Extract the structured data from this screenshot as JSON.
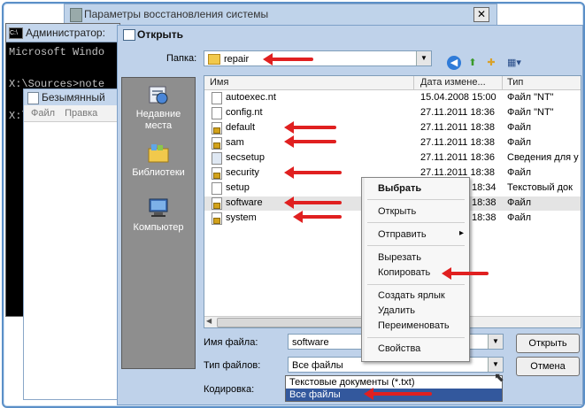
{
  "back_window": {
    "title": "Параметры восстановления системы",
    "close": "✕"
  },
  "console": {
    "title": "Администратор:",
    "icon_text": "C:\\",
    "lines": [
      "Microsoft Windo",
      "",
      "X:\\Sources>note",
      "",
      "X:\\"
    ]
  },
  "notepad": {
    "title": "Безымянный",
    "menu": "Файл  Правка"
  },
  "dialog": {
    "title": "Открыть",
    "folder_label": "Папка:",
    "folder_value": "repair",
    "places": [
      {
        "label": "Недавние места",
        "icon": "recent-places-icon"
      },
      {
        "label": "Библиотеки",
        "icon": "libraries-icon"
      },
      {
        "label": "Компьютер",
        "icon": "computer-icon"
      }
    ],
    "columns": [
      "Имя",
      "Дата измене...",
      "Тип"
    ],
    "files": [
      {
        "name": "autoexec.nt",
        "date": "15.04.2008 15:00",
        "type": "Файл \"NT\"",
        "icon": "file-icon"
      },
      {
        "name": "config.nt",
        "date": "27.11.2011 18:36",
        "type": "Файл \"NT\"",
        "icon": "file-icon"
      },
      {
        "name": "default",
        "date": "27.11.2011 18:38",
        "type": "Файл",
        "icon": "locked-file-icon"
      },
      {
        "name": "sam",
        "date": "27.11.2011 18:38",
        "type": "Файл",
        "icon": "locked-file-icon"
      },
      {
        "name": "secsetup",
        "date": "27.11.2011 18:36",
        "type": "Сведения для у",
        "icon": "settings-file-icon"
      },
      {
        "name": "security",
        "date": "27.11.2011 18:38",
        "type": "Файл",
        "icon": "locked-file-icon"
      },
      {
        "name": "setup",
        "date": "18:34",
        "type": "Текстовый док",
        "icon": "file-icon"
      },
      {
        "name": "software",
        "date": "18:38",
        "type": "Файл",
        "icon": "locked-file-icon"
      },
      {
        "name": "system",
        "date": "18:38",
        "type": "Файл",
        "icon": "locked-file-icon"
      }
    ],
    "filename_label": "Имя файла:",
    "filename_value": "software",
    "filetype_label": "Тип файлов:",
    "filetype_value": "Все файлы",
    "encoding_label": "Кодировка:",
    "open_button": "Открыть",
    "cancel_button": "Отмена",
    "filetype_options": [
      "Текстовые документы (*.txt)",
      "Все файлы"
    ]
  },
  "context_menu": {
    "items": [
      "Выбрать",
      "Открыть",
      "Отправить",
      "Вырезать",
      "Копировать",
      "Создать ярлык",
      "Удалить",
      "Переименовать",
      "Свойства"
    ],
    "submenu_arrow": "▸"
  },
  "colors": {
    "annotation_arrow": "#e02020",
    "selection": "#33589d"
  }
}
